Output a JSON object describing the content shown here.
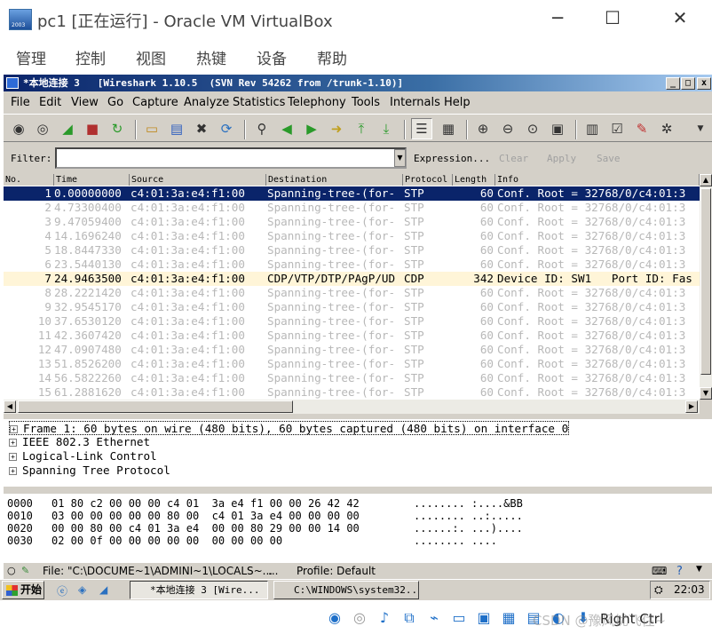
{
  "window": {
    "title": "pc1 [正在运行] - Oracle VM VirtualBox",
    "logo_text": "2003",
    "minimize": "─",
    "maximize": "☐",
    "close": "✕"
  },
  "vbox_menu": [
    "管理",
    "控制",
    "视图",
    "热键",
    "设备",
    "帮助"
  ],
  "wireshark": {
    "title": "*本地连接 3   [Wireshark 1.10.5  (SVN Rev 54262 from /trunk-1.10)]",
    "title_buttons": [
      "_",
      "□",
      "x"
    ],
    "menu": [
      "File",
      "Edit",
      "View",
      "Go",
      "Capture",
      "Analyze",
      "Statistics",
      "Telephony",
      "Tools",
      "Internals",
      "Help"
    ],
    "toolbar_icons": [
      "interfaces-icon",
      "options-icon",
      "start-icon",
      "stop-icon",
      "restart-icon",
      "open-icon",
      "save-icon",
      "close-icon",
      "reload-icon",
      "find-icon",
      "back-icon",
      "forward-icon",
      "goto-icon",
      "first-icon",
      "last-icon",
      "colorize-icon",
      "autoscroll-icon",
      "zoom-in-icon",
      "zoom-out-icon",
      "zoom-normal-icon",
      "resize-columns-icon",
      "capture-filters-icon",
      "display-filters-icon",
      "coloring-rules-icon",
      "preferences-icon",
      "help-icon"
    ],
    "filter": {
      "label": "Filter:",
      "value": "",
      "expression": "Expression...",
      "clear": "Clear",
      "apply": "Apply",
      "save": "Save"
    },
    "columns": [
      "No.",
      "Time",
      "Source",
      "Destination",
      "Protocol",
      "Length",
      "Info"
    ],
    "packets": [
      {
        "no": "1",
        "time": "0.00000000",
        "source": "c4:01:3a:e4:f1:00",
        "destination": "Spanning-tree-(for-",
        "protocol": "STP",
        "length": "60",
        "info": "Conf. Root = 32768/0/c4:01:3"
      },
      {
        "no": "2",
        "time": "4.73300400",
        "source": "c4:01:3a:e4:f1:00",
        "destination": "Spanning-tree-(for-",
        "protocol": "STP",
        "length": "60",
        "info": "Conf. Root = 32768/0/c4:01:3"
      },
      {
        "no": "3",
        "time": "9.47059400",
        "source": "c4:01:3a:e4:f1:00",
        "destination": "Spanning-tree-(for-",
        "protocol": "STP",
        "length": "60",
        "info": "Conf. Root = 32768/0/c4:01:3"
      },
      {
        "no": "4",
        "time": "14.1696240",
        "source": "c4:01:3a:e4:f1:00",
        "destination": "Spanning-tree-(for-",
        "protocol": "STP",
        "length": "60",
        "info": "Conf. Root = 32768/0/c4:01:3"
      },
      {
        "no": "5",
        "time": "18.8447330",
        "source": "c4:01:3a:e4:f1:00",
        "destination": "Spanning-tree-(for-",
        "protocol": "STP",
        "length": "60",
        "info": "Conf. Root = 32768/0/c4:01:3"
      },
      {
        "no": "6",
        "time": "23.5440130",
        "source": "c4:01:3a:e4:f1:00",
        "destination": "Spanning-tree-(for-",
        "protocol": "STP",
        "length": "60",
        "info": "Conf. Root = 32768/0/c4:01:3"
      },
      {
        "no": "7",
        "time": "24.9463500",
        "source": "c4:01:3a:e4:f1:00",
        "destination": "CDP/VTP/DTP/PAgP/UD",
        "protocol": "CDP",
        "length": "342",
        "info": "Device ID: SW1   Port ID: Fas"
      },
      {
        "no": "8",
        "time": "28.2221420",
        "source": "c4:01:3a:e4:f1:00",
        "destination": "Spanning-tree-(for-",
        "protocol": "STP",
        "length": "60",
        "info": "Conf. Root = 32768/0/c4:01:3"
      },
      {
        "no": "9",
        "time": "32.9545170",
        "source": "c4:01:3a:e4:f1:00",
        "destination": "Spanning-tree-(for-",
        "protocol": "STP",
        "length": "60",
        "info": "Conf. Root = 32768/0/c4:01:3"
      },
      {
        "no": "10",
        "time": "37.6530120",
        "source": "c4:01:3a:e4:f1:00",
        "destination": "Spanning-tree-(for-",
        "protocol": "STP",
        "length": "60",
        "info": "Conf. Root = 32768/0/c4:01:3"
      },
      {
        "no": "11",
        "time": "42.3607420",
        "source": "c4:01:3a:e4:f1:00",
        "destination": "Spanning-tree-(for-",
        "protocol": "STP",
        "length": "60",
        "info": "Conf. Root = 32768/0/c4:01:3"
      },
      {
        "no": "12",
        "time": "47.0907480",
        "source": "c4:01:3a:e4:f1:00",
        "destination": "Spanning-tree-(for-",
        "protocol": "STP",
        "length": "60",
        "info": "Conf. Root = 32768/0/c4:01:3"
      },
      {
        "no": "13",
        "time": "51.8526200",
        "source": "c4:01:3a:e4:f1:00",
        "destination": "Spanning-tree-(for-",
        "protocol": "STP",
        "length": "60",
        "info": "Conf. Root = 32768/0/c4:01:3"
      },
      {
        "no": "14",
        "time": "56.5822260",
        "source": "c4:01:3a:e4:f1:00",
        "destination": "Spanning-tree-(for-",
        "protocol": "STP",
        "length": "60",
        "info": "Conf. Root = 32768/0/c4:01:3"
      },
      {
        "no": "15",
        "time": "61.2881620",
        "source": "c4:01:3a:e4:f1:00",
        "destination": "Spanning-tree-(for-",
        "protocol": "STP",
        "length": "60",
        "info": "Conf. Root = 32768/0/c4:01:3"
      }
    ],
    "details": [
      "Frame 1: 60 bytes on wire (480 bits), 60 bytes captured (480 bits) on interface 0",
      "IEEE 802.3 Ethernet",
      "Logical-Link Control",
      "Spanning Tree Protocol"
    ],
    "hex": [
      {
        "offset": "0000",
        "bytes": "01 80 c2 00 00 00 c4 01  3a e4 f1 00 00 26 42 42",
        "ascii": "........ :....&BB"
      },
      {
        "offset": "0010",
        "bytes": "03 00 00 00 00 00 80 00  c4 01 3a e4 00 00 00 00",
        "ascii": "........ ..:....."
      },
      {
        "offset": "0020",
        "bytes": "00 00 80 00 c4 01 3a e4  00 00 80 29 00 00 14 00",
        "ascii": "......:. ...)...."
      },
      {
        "offset": "0030",
        "bytes": "02 00 0f 00 00 00 00 00  00 00 00 00",
        "ascii": "........ ...."
      }
    ],
    "status": {
      "file": "File: \"C:\\DOCUME~1\\ADMINI~1\\LOCALS~...",
      "middle": "...",
      "profile": "Profile: Default"
    }
  },
  "taskbar": {
    "start": "开始",
    "tasks": [
      "*本地连接 3    [Wire...",
      "C:\\WINDOWS\\system32..."
    ],
    "clock": "22:03"
  },
  "vbox_status": {
    "host_key": "Right Ctrl",
    "watermark": "CSDN @豫风扰飞住~"
  }
}
